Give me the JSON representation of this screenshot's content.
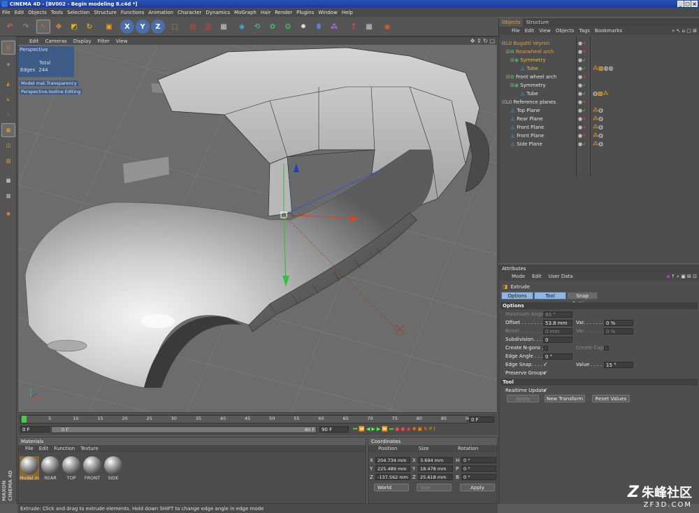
{
  "window": {
    "title": "CINEMA 4D - [BV002 - Begin modeling 8.c4d *]",
    "controls": [
      "_",
      "□",
      "×"
    ]
  },
  "menubar": [
    "File",
    "Edit",
    "Objects",
    "Tools",
    "Selection",
    "Structure",
    "Functions",
    "Animation",
    "Character",
    "Dynamics",
    "MoGraph",
    "Hair",
    "Render",
    "Plugins",
    "Window",
    "Help"
  ],
  "viewport": {
    "menu": [
      "Edit",
      "Cameras",
      "Display",
      "Filter",
      "View"
    ],
    "view_name": "Perspective",
    "hud_total_label": "Total",
    "hud_edges_label": "Edges",
    "hud_edges_value": "244",
    "overlay_line1": "Model mat.Transparency",
    "overlay_line2": "Perspective.Isoline Editing"
  },
  "timeline": {
    "ticks": [
      "0",
      "5",
      "10",
      "15",
      "20",
      "25",
      "30",
      "35",
      "40",
      "45",
      "50",
      "55",
      "60",
      "65",
      "70",
      "75",
      "80",
      "85",
      "90"
    ],
    "current_frame": "0 F",
    "start_field": "0 F",
    "range_start": "0 F",
    "range_end": "90 F",
    "end_field": "90 F"
  },
  "materials": {
    "title": "Materials",
    "menu": [
      "File",
      "Edit",
      "Function",
      "Texture"
    ],
    "items": [
      "Model m",
      "REAR",
      "TOP",
      "FRONT",
      "SIDE"
    ]
  },
  "coordinates": {
    "title": "Coordinates",
    "headers": [
      "Position",
      "Size",
      "Rotation"
    ],
    "rows": [
      {
        "axis": "X",
        "pos": "204.734 mm",
        "saxis": "X",
        "size": "3.694 mm",
        "raxis": "H",
        "rot": "0 °"
      },
      {
        "axis": "Y",
        "pos": "225.489 mm",
        "saxis": "Y",
        "size": "18.478 mm",
        "raxis": "P",
        "rot": "0 °"
      },
      {
        "axis": "Z",
        "pos": "-137.562 mm",
        "saxis": "Z",
        "size": "25.618 mm",
        "raxis": "B",
        "rot": "0 °"
      }
    ],
    "mode_select": "World",
    "size_select": "Size",
    "apply_label": "Apply"
  },
  "statusbar": "Extrude: Click and drag to extrude elements. Hold down SHIFT to change edge angle in edge mode",
  "objects_panel": {
    "tabs": [
      "Objects",
      "Structure"
    ],
    "menu": [
      "File",
      "Edit",
      "View",
      "Objects",
      "Tags",
      "Bookmarks"
    ],
    "rows": [
      {
        "indent": 0,
        "name": "Bugatti Veyron",
        "color": "#e8a030"
      },
      {
        "indent": 1,
        "name": "Rearwheel arch",
        "color": "#e8a030"
      },
      {
        "indent": 2,
        "name": "Symmetry",
        "color": "#e8c030"
      },
      {
        "indent": 3,
        "name": "Tube",
        "color": "#e8c030"
      },
      {
        "indent": 1,
        "name": "Front wheel arch",
        "color": "#e0e0e0"
      },
      {
        "indent": 2,
        "name": "Symmetry",
        "color": "#e0e0e0"
      },
      {
        "indent": 3,
        "name": "Tube",
        "color": "#e0e0e0"
      },
      {
        "indent": 0,
        "name": "Reference planes",
        "color": "#e0e0e0"
      },
      {
        "indent": 1,
        "name": "Top Plane",
        "color": "#e0e0e0"
      },
      {
        "indent": 1,
        "name": "Rear Plane",
        "color": "#e0e0e0"
      },
      {
        "indent": 1,
        "name": "Front Plane",
        "color": "#e0e0e0"
      },
      {
        "indent": 1,
        "name": "Front Plane",
        "color": "#e0e0e0"
      },
      {
        "indent": 1,
        "name": "Side Plane",
        "color": "#e0e0e0"
      }
    ]
  },
  "attributes": {
    "title": "Attributes",
    "menu": [
      "Mode",
      "Edit",
      "User Data"
    ],
    "tool_name": "Extrude",
    "tabs": [
      "Options",
      "Tool",
      "Snap Settings"
    ],
    "section_options": "Options",
    "max_angle_label": "Maximum Angle",
    "max_angle_value": "89 °",
    "offset_label": "Offset . . . . . . . .",
    "offset_value": "53.8 mm",
    "var1_label": "Var. . . . . . .",
    "var1_value": "0 %",
    "bevel_label": "Bevel . . . . . . . .",
    "bevel_value": "0 mm",
    "var2_label": "Var. . . . . . .",
    "var2_value": "0 %",
    "subdiv_label": "Subdivision. . . . .",
    "subdiv_value": "0",
    "ngons_label": "Create N-gons . .",
    "caps_label": "Create Caps",
    "edge_angle_label": "Edge Angle . . . .",
    "edge_angle_value": "0 °",
    "edge_snap_label": "Edge Snap. . . . .",
    "edge_snap_check": "✓",
    "value_label": "Value . . . . .",
    "value_value": "15 °",
    "preserve_label": "Preserve Groups",
    "preserve_check": "✓",
    "section_tool": "Tool",
    "realtime_label": "Realtime Update",
    "realtime_check": "✓",
    "apply_label": "Apply",
    "new_transform_label": "New Transform",
    "reset_values_label": "Reset Values"
  },
  "watermark": {
    "logo_text": "朱峰社区",
    "url": "ZF3D.COM"
  }
}
